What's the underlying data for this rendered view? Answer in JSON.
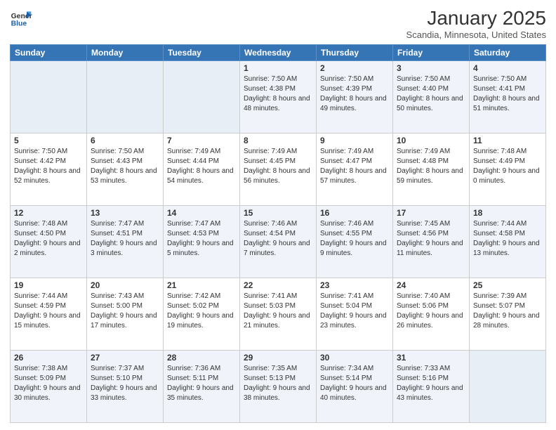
{
  "logo": {
    "text_general": "General",
    "text_blue": "Blue"
  },
  "header": {
    "month": "January 2025",
    "location": "Scandia, Minnesota, United States"
  },
  "weekdays": [
    "Sunday",
    "Monday",
    "Tuesday",
    "Wednesday",
    "Thursday",
    "Friday",
    "Saturday"
  ],
  "weeks": [
    [
      {
        "day": "",
        "empty": true
      },
      {
        "day": "",
        "empty": true
      },
      {
        "day": "",
        "empty": true
      },
      {
        "day": "1",
        "sunrise": "7:50 AM",
        "sunset": "4:38 PM",
        "daylight": "8 hours and 48 minutes."
      },
      {
        "day": "2",
        "sunrise": "7:50 AM",
        "sunset": "4:39 PM",
        "daylight": "8 hours and 49 minutes."
      },
      {
        "day": "3",
        "sunrise": "7:50 AM",
        "sunset": "4:40 PM",
        "daylight": "8 hours and 50 minutes."
      },
      {
        "day": "4",
        "sunrise": "7:50 AM",
        "sunset": "4:41 PM",
        "daylight": "8 hours and 51 minutes."
      }
    ],
    [
      {
        "day": "5",
        "sunrise": "7:50 AM",
        "sunset": "4:42 PM",
        "daylight": "8 hours and 52 minutes."
      },
      {
        "day": "6",
        "sunrise": "7:50 AM",
        "sunset": "4:43 PM",
        "daylight": "8 hours and 53 minutes."
      },
      {
        "day": "7",
        "sunrise": "7:49 AM",
        "sunset": "4:44 PM",
        "daylight": "8 hours and 54 minutes."
      },
      {
        "day": "8",
        "sunrise": "7:49 AM",
        "sunset": "4:45 PM",
        "daylight": "8 hours and 56 minutes."
      },
      {
        "day": "9",
        "sunrise": "7:49 AM",
        "sunset": "4:47 PM",
        "daylight": "8 hours and 57 minutes."
      },
      {
        "day": "10",
        "sunrise": "7:49 AM",
        "sunset": "4:48 PM",
        "daylight": "8 hours and 59 minutes."
      },
      {
        "day": "11",
        "sunrise": "7:48 AM",
        "sunset": "4:49 PM",
        "daylight": "9 hours and 0 minutes."
      }
    ],
    [
      {
        "day": "12",
        "sunrise": "7:48 AM",
        "sunset": "4:50 PM",
        "daylight": "9 hours and 2 minutes."
      },
      {
        "day": "13",
        "sunrise": "7:47 AM",
        "sunset": "4:51 PM",
        "daylight": "9 hours and 3 minutes."
      },
      {
        "day": "14",
        "sunrise": "7:47 AM",
        "sunset": "4:53 PM",
        "daylight": "9 hours and 5 minutes."
      },
      {
        "day": "15",
        "sunrise": "7:46 AM",
        "sunset": "4:54 PM",
        "daylight": "9 hours and 7 minutes."
      },
      {
        "day": "16",
        "sunrise": "7:46 AM",
        "sunset": "4:55 PM",
        "daylight": "9 hours and 9 minutes."
      },
      {
        "day": "17",
        "sunrise": "7:45 AM",
        "sunset": "4:56 PM",
        "daylight": "9 hours and 11 minutes."
      },
      {
        "day": "18",
        "sunrise": "7:44 AM",
        "sunset": "4:58 PM",
        "daylight": "9 hours and 13 minutes."
      }
    ],
    [
      {
        "day": "19",
        "sunrise": "7:44 AM",
        "sunset": "4:59 PM",
        "daylight": "9 hours and 15 minutes."
      },
      {
        "day": "20",
        "sunrise": "7:43 AM",
        "sunset": "5:00 PM",
        "daylight": "9 hours and 17 minutes."
      },
      {
        "day": "21",
        "sunrise": "7:42 AM",
        "sunset": "5:02 PM",
        "daylight": "9 hours and 19 minutes."
      },
      {
        "day": "22",
        "sunrise": "7:41 AM",
        "sunset": "5:03 PM",
        "daylight": "9 hours and 21 minutes."
      },
      {
        "day": "23",
        "sunrise": "7:41 AM",
        "sunset": "5:04 PM",
        "daylight": "9 hours and 23 minutes."
      },
      {
        "day": "24",
        "sunrise": "7:40 AM",
        "sunset": "5:06 PM",
        "daylight": "9 hours and 26 minutes."
      },
      {
        "day": "25",
        "sunrise": "7:39 AM",
        "sunset": "5:07 PM",
        "daylight": "9 hours and 28 minutes."
      }
    ],
    [
      {
        "day": "26",
        "sunrise": "7:38 AM",
        "sunset": "5:09 PM",
        "daylight": "9 hours and 30 minutes."
      },
      {
        "day": "27",
        "sunrise": "7:37 AM",
        "sunset": "5:10 PM",
        "daylight": "9 hours and 33 minutes."
      },
      {
        "day": "28",
        "sunrise": "7:36 AM",
        "sunset": "5:11 PM",
        "daylight": "9 hours and 35 minutes."
      },
      {
        "day": "29",
        "sunrise": "7:35 AM",
        "sunset": "5:13 PM",
        "daylight": "9 hours and 38 minutes."
      },
      {
        "day": "30",
        "sunrise": "7:34 AM",
        "sunset": "5:14 PM",
        "daylight": "9 hours and 40 minutes."
      },
      {
        "day": "31",
        "sunrise": "7:33 AM",
        "sunset": "5:16 PM",
        "daylight": "9 hours and 43 minutes."
      },
      {
        "day": "",
        "empty": true
      }
    ]
  ],
  "labels": {
    "sunrise": "Sunrise:",
    "sunset": "Sunset:",
    "daylight": "Daylight hours"
  }
}
